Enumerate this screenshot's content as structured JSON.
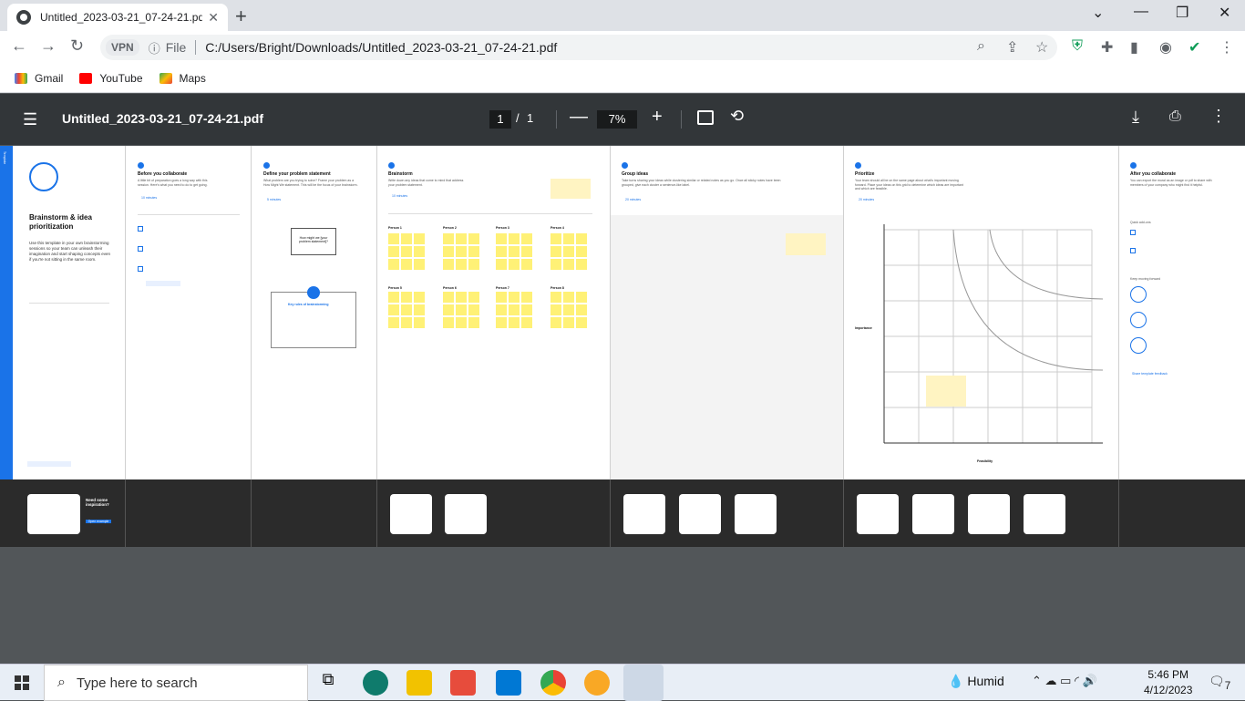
{
  "browser": {
    "tab_title": "Untitled_2023-03-21_07-24-21.pdf",
    "tab_close": "✕",
    "new_tab": "+",
    "address": "C:/Users/Bright/Downloads/Untitled_2023-03-21_07-24-21.pdf",
    "file_label": "File",
    "vpn_label": "VPN",
    "bookmarks": [
      {
        "label": "Gmail",
        "color": "#ea4335"
      },
      {
        "label": "YouTube",
        "color": "#ff0000"
      },
      {
        "label": "Maps",
        "color": "#34a853"
      }
    ]
  },
  "pdf": {
    "title": "Untitled_2023-03-21_07-24-21.pdf",
    "page_current": "1",
    "page_sep": "/",
    "page_total": "1",
    "zoom": "7%",
    "panels": {
      "cover": {
        "title": "Brainstorm & idea prioritization",
        "sidebar": "Template",
        "body": "Use this template in your own brainstorming sessions so your team can unleash their imagination and start shaping concepts even if you're not sitting in the same room."
      },
      "before": {
        "title": "Before you collaborate",
        "body": "A little bit of preparation goes a long way with this session. Here's what you need to do to get going.",
        "time": "10 minutes"
      },
      "define": {
        "title": "Define your problem statement",
        "body": "What problem are you trying to solve? Frame your problem as a How Might We statement. This will be the focus of your brainstorm.",
        "time": "5 minutes",
        "card": "How might we [your problem statement]?",
        "rules_title": "Key rules of brainstorming"
      },
      "brainstorm": {
        "title": "Brainstorm",
        "body": "Write down any ideas that come to mind that address your problem statement.",
        "time": "10 minutes",
        "people": [
          "Person 1",
          "Person 2",
          "Person 3",
          "Person 4",
          "Person 5",
          "Person 6",
          "Person 7",
          "Person 8"
        ]
      },
      "group": {
        "title": "Group ideas",
        "body": "Take turns sharing your ideas while clustering similar or related notes as you go. Once all sticky notes have been grouped, give each cluster a sentence-like label.",
        "time": "20 minutes"
      },
      "prioritize": {
        "title": "Prioritize",
        "body": "Your team should all be on the same page about what's important moving forward. Place your ideas on this grid to determine which ideas are important and which are feasible.",
        "time": "20 minutes",
        "y_label": "Importance",
        "x_label": "Feasibility"
      },
      "after": {
        "title": "After you collaborate",
        "body": "You can export the mural as an image or pdf to share with members of your company who might find it helpful.",
        "quick": "Quick add-ons",
        "keep": "Keep moving forward",
        "share": "Share template feedback"
      }
    },
    "strip": {
      "inspiration_title": "Need some inspiration?",
      "inspiration_btn": "Open example"
    }
  },
  "taskbar": {
    "search_placeholder": "Type here to search",
    "weather": "Humid",
    "time": "5:46 PM",
    "date": "4/12/2023",
    "notifications": "7"
  }
}
